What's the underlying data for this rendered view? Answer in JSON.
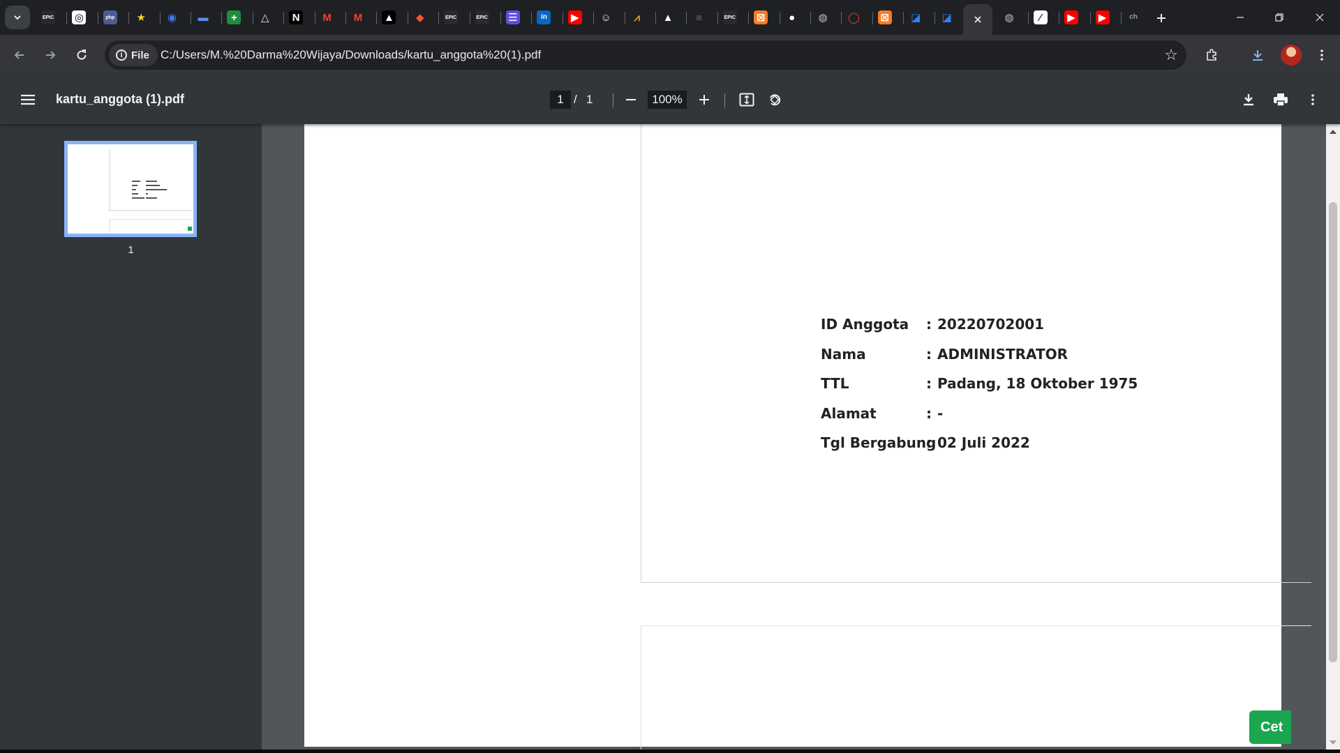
{
  "browser": {
    "tab_favicons": [
      {
        "name": "epic-games",
        "text": "EPIC",
        "bg": "#2a2a2a",
        "fg": "#ffffff"
      },
      {
        "name": "openai",
        "text": "◎",
        "bg": "#ffffff",
        "fg": "#000000"
      },
      {
        "name": "php",
        "text": "php",
        "bg": "#4f5b93",
        "fg": "#ffffff"
      },
      {
        "name": "star",
        "text": "★",
        "bg": "transparent",
        "fg": "#f9d71c"
      },
      {
        "name": "blue-circle",
        "text": "◉",
        "bg": "transparent",
        "fg": "#3d7bfd"
      },
      {
        "name": "bar",
        "text": "▬",
        "bg": "transparent",
        "fg": "#5b8def"
      },
      {
        "name": "green-plus",
        "text": "+",
        "bg": "#1e8e3e",
        "fg": "#ffffff"
      },
      {
        "name": "drop",
        "text": "△",
        "bg": "transparent",
        "fg": "#e8eaed"
      },
      {
        "name": "notion",
        "text": "N",
        "bg": "#000000",
        "fg": "#ffffff"
      },
      {
        "name": "gmail",
        "text": "M",
        "bg": "transparent",
        "fg": "#ea4335"
      },
      {
        "name": "gmail-2",
        "text": "M",
        "bg": "transparent",
        "fg": "#ea4335"
      },
      {
        "name": "triangle",
        "text": "▲",
        "bg": "#000000",
        "fg": "#ffffff"
      },
      {
        "name": "brave",
        "text": "◆",
        "bg": "transparent",
        "fg": "#fb542b"
      },
      {
        "name": "epic-games-2",
        "text": "EPIC",
        "bg": "#2a2a2a",
        "fg": "#ffffff"
      },
      {
        "name": "epic-games-3",
        "text": "EPIC",
        "bg": "#2a2a2a",
        "fg": "#ffffff"
      },
      {
        "name": "list",
        "text": "☰",
        "bg": "#5b4fe0",
        "fg": "#ffffff"
      },
      {
        "name": "linkedin",
        "text": "in",
        "bg": "#0a66c2",
        "fg": "#ffffff"
      },
      {
        "name": "youtube",
        "text": "▶",
        "bg": "#ff0000",
        "fg": "#ffffff"
      },
      {
        "name": "panda",
        "text": "☺",
        "bg": "transparent",
        "fg": "#e8eaed"
      },
      {
        "name": "mountain",
        "text": "⩘",
        "bg": "transparent",
        "fg": "#e8a13a"
      },
      {
        "name": "up-triangle",
        "text": "▲",
        "bg": "transparent",
        "fg": "#ffffff"
      },
      {
        "name": "dark-box",
        "text": "■",
        "bg": "transparent",
        "fg": "#444444"
      },
      {
        "name": "epic-games-4",
        "text": "EPIC",
        "bg": "#2a2a2a",
        "fg": "#ffffff"
      },
      {
        "name": "xampp",
        "text": "⊠",
        "bg": "#fb7a24",
        "fg": "#ffffff"
      },
      {
        "name": "github",
        "text": "●",
        "bg": "transparent",
        "fg": "#ffffff"
      },
      {
        "name": "globe",
        "text": "◍",
        "bg": "transparent",
        "fg": "#bdc1c6"
      },
      {
        "name": "red-ring",
        "text": "◯",
        "bg": "transparent",
        "fg": "#ea4335"
      },
      {
        "name": "xampp-2",
        "text": "⊠",
        "bg": "#fb7a24",
        "fg": "#ffffff"
      },
      {
        "name": "figma-like",
        "text": "◪",
        "bg": "transparent",
        "fg": "#2f80ed"
      },
      {
        "name": "figma-like-2",
        "text": "◪",
        "bg": "transparent",
        "fg": "#2f80ed"
      }
    ],
    "tab_favicons_after": [
      {
        "name": "globe-2",
        "text": "◍",
        "bg": "transparent",
        "fg": "#bdc1c6"
      },
      {
        "name": "slash",
        "text": "⁄",
        "bg": "#ffffff",
        "fg": "#1a237e"
      },
      {
        "name": "youtube-2",
        "text": "▶",
        "bg": "#ff0000",
        "fg": "#ffffff"
      },
      {
        "name": "youtube-3",
        "text": "▶",
        "bg": "#ff0000",
        "fg": "#ffffff"
      },
      {
        "name": "ch",
        "text": "ch",
        "bg": "transparent",
        "fg": "#9aa0a6"
      }
    ],
    "site_chip_label": "File",
    "url": "C:/Users/M.%20Darma%20Wijaya/Downloads/kartu_anggota%20(1).pdf"
  },
  "pdf": {
    "title": "kartu_anggota (1).pdf",
    "current_page": "1",
    "page_separator": "/",
    "total_pages": "1",
    "zoom": "100%",
    "thumbnail_label": "1"
  },
  "card": {
    "rows": [
      {
        "label": "ID Anggota",
        "colon": ":",
        "value": "20220702001"
      },
      {
        "label": "Nama",
        "colon": ":",
        "value": "ADMINISTRATOR"
      },
      {
        "label": "TTL",
        "colon": ":",
        "value": "Padang, 18 Oktober 1975"
      },
      {
        "label": "Alamat",
        "colon": ":",
        "value": "-"
      },
      {
        "label": "Tgl Bergabung",
        "colon": ":",
        "value": "02 Juli 2022"
      }
    ],
    "print_button_label": "Cet"
  }
}
